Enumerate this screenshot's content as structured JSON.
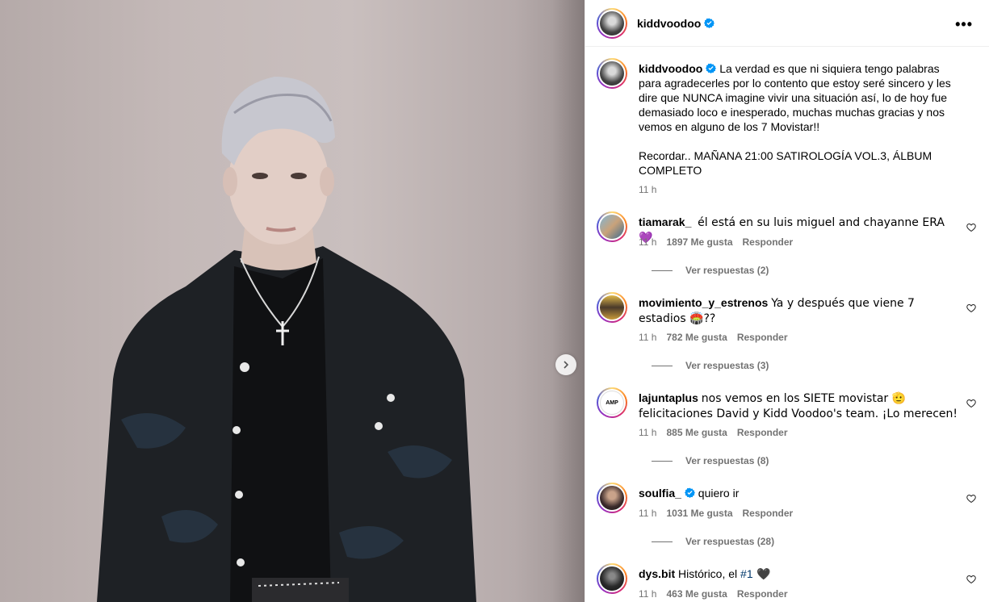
{
  "post": {
    "username": "kiddvoodoo",
    "more_label": "•••",
    "caption_username": "kiddvoodoo",
    "caption_text": "La verdad es que ni siquiera tengo palabras para agradecerles por lo contento que estoy seré sincero y les dire que NUNCA imagine vivir una situación así, lo de hoy fue demasiado loco e inesperado, muchas muchas gracias y nos vemos en alguno de los 7 Movistar!!",
    "caption_text2": "Recordar.. MAÑANA 21:00 SATIROLOGÍA VOL.3, ÁLBUM COMPLETO",
    "caption_time": "11 h"
  },
  "comments": [
    {
      "username": "tiamarak_",
      "text": "él está en su luis miguel and chayanne ERA 💜",
      "time": "11 h",
      "likes": "1897 Me gusta",
      "reply": "Responder",
      "replies": "Ver respuestas (2)"
    },
    {
      "username": "movimiento_y_estrenos",
      "text": "Ya y después que viene 7 estadios 🏟️??",
      "time": "11 h",
      "likes": "782 Me gusta",
      "reply": "Responder",
      "replies": "Ver respuestas (3)"
    },
    {
      "username": "lajuntaplus",
      "text": "nos vemos en los SIETE movistar 🫡 felicitaciones David y Kidd Voodoo's team. ¡Lo merecen!",
      "time": "11 h",
      "likes": "885 Me gusta",
      "reply": "Responder",
      "replies": "Ver respuestas (8)"
    },
    {
      "username": "soulfia_",
      "text": "quiero ir",
      "time": "11 h",
      "likes": "1031 Me gusta",
      "reply": "Responder",
      "replies": "Ver respuestas (28)"
    },
    {
      "username": "dys.bit",
      "text_pre": "Histórico, el ",
      "hashtag": "#1",
      "text_post": " 🖤",
      "time": "11 h",
      "likes": "463 Me gusta",
      "reply": "Responder"
    }
  ],
  "icons": {
    "verified": "verified-badge-icon",
    "heart": "heart-icon",
    "next": "chevron-right-icon",
    "more": "more-options-icon"
  },
  "colors": {
    "verified": "#0095f6",
    "hashtag": "#00376b",
    "muted": "#737373"
  }
}
